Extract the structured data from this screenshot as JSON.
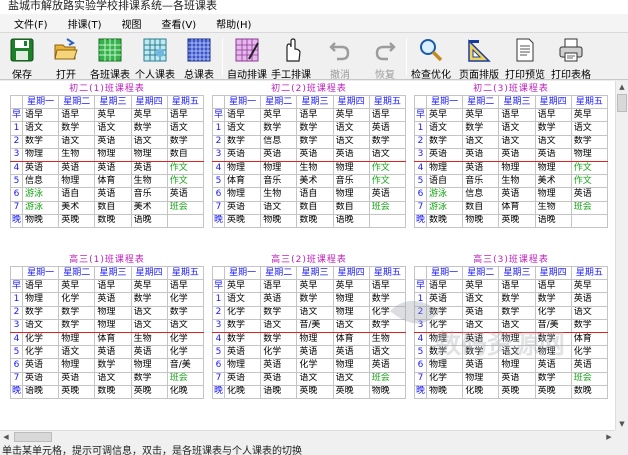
{
  "app": {
    "title": "盐城市解放路实验学校排课系统—各班课表"
  },
  "menu": [
    "文件(F)",
    "排课(T)",
    "视图",
    "查看(V)",
    "帮助(H)"
  ],
  "toolbar": [
    {
      "label": "保存",
      "icon": "save-icon",
      "enabled": true
    },
    {
      "label": "打开",
      "icon": "open-folder-icon",
      "enabled": true
    },
    {
      "label": "各班课表",
      "icon": "class-schedule-icon",
      "enabled": true
    },
    {
      "label": "个人课表",
      "icon": "personal-schedule-icon",
      "enabled": true
    },
    {
      "label": "总课表",
      "icon": "master-schedule-icon",
      "enabled": true
    },
    {
      "label": "自动排课",
      "icon": "auto-schedule-icon",
      "enabled": true
    },
    {
      "label": "手工排课",
      "icon": "manual-schedule-icon",
      "enabled": true
    },
    {
      "label": "撤消",
      "icon": "undo-icon",
      "enabled": false
    },
    {
      "label": "恢复",
      "icon": "redo-icon",
      "enabled": false
    },
    {
      "label": "检查优化",
      "icon": "check-optimize-icon",
      "enabled": true
    },
    {
      "label": "页面排版",
      "icon": "page-layout-icon",
      "enabled": true
    },
    {
      "label": "打印预览",
      "icon": "print-preview-icon",
      "enabled": true
    },
    {
      "label": "打印表格",
      "icon": "print-icon",
      "enabled": true
    }
  ],
  "header": [
    "",
    "星期一",
    "星期二",
    "星期三",
    "星期四",
    "星期五"
  ],
  "periods": [
    "早",
    "1",
    "2",
    "3",
    "4",
    "5",
    "6",
    "7",
    "晚"
  ],
  "schedules": [
    {
      "title": "初二(1)班课程表",
      "rows": [
        [
          "语早",
          "语早",
          "英早",
          "英早",
          "语早"
        ],
        [
          "语文",
          "数学",
          "语文",
          "数学",
          "语文"
        ],
        [
          "数学",
          "语文",
          "英语",
          "语文",
          "数学"
        ],
        [
          "物理",
          "生物",
          "物理",
          "物理",
          "数自"
        ],
        [
          "英语",
          "英语",
          "英语",
          "英语",
          "作文"
        ],
        [
          "信息",
          "物理",
          "体育",
          "生物",
          "作文"
        ],
        [
          "游泳",
          "语自",
          "英语",
          "音乐",
          "英语"
        ],
        [
          "游泳",
          "美术",
          "数自",
          "美术",
          "班会"
        ],
        [
          "物晚",
          "英晚",
          "数晚",
          "语晚",
          ""
        ]
      ]
    },
    {
      "title": "初二(2)班课程表",
      "rows": [
        [
          "语早",
          "英早",
          "语早",
          "英早",
          "语早"
        ],
        [
          "语文",
          "数学",
          "数学",
          "语文",
          "英语"
        ],
        [
          "数学",
          "信息",
          "数学",
          "语文",
          "数学"
        ],
        [
          "英语",
          "英语",
          "英语",
          "英语",
          "语文"
        ],
        [
          "物理",
          "物理",
          "生物",
          "物理",
          "作文"
        ],
        [
          "体育",
          "音乐",
          "美术",
          "音乐",
          "作文"
        ],
        [
          "物理",
          "生物",
          "语自",
          "物理",
          "英语"
        ],
        [
          "英语",
          "语文",
          "数自",
          "数自",
          "班会"
        ],
        [
          "英晚",
          "物晚",
          "数晚",
          "语晚",
          ""
        ]
      ]
    },
    {
      "title": "初二(3)班课程表",
      "rows": [
        [
          "英早",
          "英早",
          "语早",
          "语早",
          "英早"
        ],
        [
          "语文",
          "数学",
          "语文",
          "数学",
          "语文"
        ],
        [
          "数学",
          "语文",
          "语文",
          "语文",
          "数学"
        ],
        [
          "英语",
          "英语",
          "英语",
          "英语",
          "物理"
        ],
        [
          "物理",
          "英语",
          "物理",
          "物理",
          "作文"
        ],
        [
          "语自",
          "音乐",
          "生物",
          "美术",
          "作文"
        ],
        [
          "游泳",
          "信息",
          "英语",
          "物理",
          "英语"
        ],
        [
          "游泳",
          "数自",
          "体育",
          "生物",
          "班会"
        ],
        [
          "数晚",
          "物晚",
          "英晚",
          "语晚",
          ""
        ]
      ]
    },
    {
      "title": "高三(1)班课程表",
      "rows": [
        [
          "语早",
          "英早",
          "语早",
          "英早",
          "语早"
        ],
        [
          "物理",
          "化学",
          "英语",
          "数学",
          "化学"
        ],
        [
          "数学",
          "数学",
          "物理",
          "语文",
          "数学"
        ],
        [
          "语文",
          "数学",
          "物理",
          "语文",
          "语文"
        ],
        [
          "化学",
          "物理",
          "体育",
          "生物",
          "化学"
        ],
        [
          "化学",
          "语文",
          "英语",
          "英语",
          "化学"
        ],
        [
          "英语",
          "物理",
          "数学",
          "物理",
          "音/美"
        ],
        [
          "英语",
          "英语",
          "语文",
          "数学",
          "班会"
        ],
        [
          "语晚",
          "英晚",
          "数晚",
          "英晚",
          "化晚"
        ]
      ]
    },
    {
      "title": "高三(2)班课程表",
      "rows": [
        [
          "英早",
          "语早",
          "英早",
          "英早",
          "语早"
        ],
        [
          "语文",
          "英语",
          "数学",
          "物理",
          "数学"
        ],
        [
          "化学",
          "数学",
          "语文",
          "物理",
          "化学"
        ],
        [
          "数学",
          "语文",
          "音/美",
          "语文",
          "数学"
        ],
        [
          "数学",
          "数学",
          "物理",
          "体育",
          "生物"
        ],
        [
          "英语",
          "化学",
          "英语",
          "英语",
          "语文"
        ],
        [
          "物理",
          "英语",
          "化学",
          "物理",
          "英语"
        ],
        [
          "英语",
          "英语",
          "语文",
          "语文",
          "班会"
        ],
        [
          "化晚",
          "语晚",
          "英晚",
          "英晚",
          "物晚"
        ]
      ]
    },
    {
      "title": "高三(3)班课程表",
      "rows": [
        [
          "语早",
          "英早",
          "语早",
          "语早",
          "英早"
        ],
        [
          "英语",
          "语文",
          "数学",
          "数学",
          "英语"
        ],
        [
          "数学",
          "英语",
          "数学",
          "化学",
          "语文"
        ],
        [
          "化学",
          "语文",
          "语文",
          "音/美",
          "数学"
        ],
        [
          "物理",
          "英语",
          "物理",
          "数学",
          "体育"
        ],
        [
          "数学",
          "数学",
          "语文",
          "物理",
          "化学"
        ],
        [
          "物理",
          "英语",
          "物理",
          "英语",
          "英语"
        ],
        [
          "化学",
          "物理",
          "英语",
          "数学",
          "班会"
        ],
        [
          "物晚",
          "化晚",
          "英晚",
          "英晚",
          "数晚"
        ]
      ]
    }
  ],
  "watermark": "数码资源网",
  "status": "单击某单元格，提示可调信息，双击，是各班课表与个人课表的切换"
}
